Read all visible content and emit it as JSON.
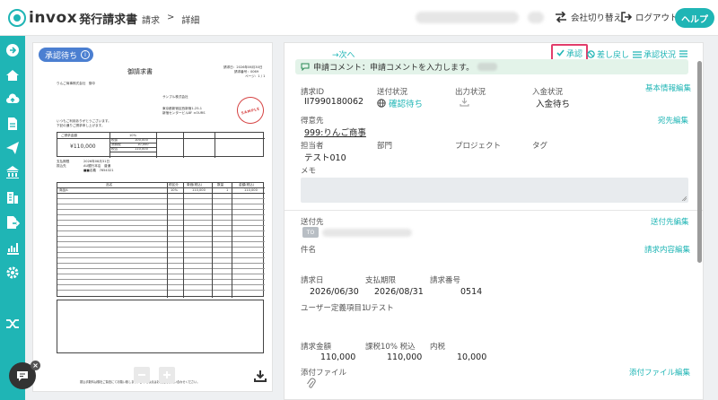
{
  "header": {
    "logo_text": "invox",
    "logo_sub": "発行請求書",
    "breadcrumb": [
      "請求",
      ">",
      "詳細"
    ],
    "switch_company": "会社切り替え",
    "logout": "ログアウト",
    "help": "ヘルプ"
  },
  "document": {
    "status": "承認待ち",
    "title": "御請求書",
    "date_line": "請求日：2026年06月30日",
    "number_line": "請求番号：0069",
    "page_line": "ページ：1 / 1",
    "customer": "りんご商事株式会社　御中",
    "issuer": "サンプル株式会社",
    "issuer_addr": "東京都新宿区西新宿1-25-1",
    "issuer_bldg": "新宿センタービル8F ×OURS",
    "greeting1": "いつもご利用ありがとうございます。",
    "greeting2": "下記の通りご請求申し上げます。",
    "stamp": "SAMPLE",
    "amount_label": "ご請求金額",
    "amount": "¥110,000",
    "rate_label": "10%",
    "tax_rows": [
      [
        "税抜",
        "100,000"
      ],
      [
        "消費税",
        "10,000"
      ],
      [
        "税込",
        "110,000"
      ]
    ],
    "pay_label": "支払期限",
    "pay_date": "2026年08月31日",
    "bank_label": "振込先",
    "bank": "AU銀行本店　普通",
    "acct": "■■名義　7654321",
    "cols": [
      "品名",
      "税区分",
      "単価(税込)",
      "数量",
      "金額(税込)"
    ],
    "row1": [
      "商品A",
      "10%",
      "110,000",
      "1",
      "110,000"
    ],
    "footer_note": "振込手数料は御社ご負担にてお願い致します。ご不明な点はお気軽にお問い合わせください。"
  },
  "toolbar": {
    "next": "→次へ",
    "approve": "承認",
    "reject": "差し戻し",
    "approval_status": "承認状況"
  },
  "comment": "申請コメント：申請コメントを入力します。",
  "fields": {
    "invoice_id_label": "請求ID",
    "invoice_id": "II7990180062",
    "send_status_label": "送付状況",
    "send_status": "確認待ち",
    "output_status_label": "出力状況",
    "payment_status_label": "入金状況",
    "payment_status": "入金待ち",
    "edit_basic": "基本情報編集",
    "customer_label": "得意先",
    "customer": "999:りんご商事",
    "edit_customer": "宛先編集",
    "owner_label": "担当者",
    "owner": "テスト010",
    "dept_label": "部門",
    "project_label": "プロジェクト",
    "tag_label": "タグ",
    "memo_label": "メモ",
    "send_to_label": "送付先",
    "to_badge": "TO",
    "edit_send_to": "送付先編集",
    "subject_label": "件名",
    "edit_content": "請求内容編集",
    "invoice_date_label": "請求日",
    "invoice_date": "2026/06/30",
    "due_date_label": "支払期限",
    "due_date": "2026/08/31",
    "invoice_no_label": "請求番号",
    "invoice_no": "0514",
    "user_field_label": "ユーザー定義項目1",
    "user_field": "Uテスト",
    "amount_label": "請求金額",
    "amount": "110,000",
    "tax_label": "課税10% 税込",
    "tax_amount": "110,000",
    "inner_tax_label": "内税",
    "inner_tax": "10,000",
    "attach_label": "添付ファイル",
    "edit_attach": "添付ファイル編集"
  },
  "colors": {
    "accent": "#1fb5b5",
    "status_blue": "#4b7fd1",
    "approve_border": "#e23d6b",
    "stamp_red": "#d64545"
  }
}
